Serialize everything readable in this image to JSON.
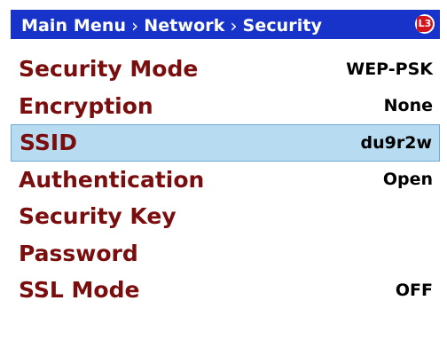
{
  "header": {
    "breadcrumb": [
      "Main Menu",
      "Network",
      "Security"
    ],
    "separator": "›",
    "logo_text": "L3"
  },
  "colors": {
    "header_bg": "#1733c9",
    "label_text": "#7a0e0e",
    "selected_bg": "#b7dbf1",
    "logo_red": "#d4141b"
  },
  "menu": {
    "items": [
      {
        "label": "Security Mode",
        "value": "WEP-PSK"
      },
      {
        "label": "Encryption",
        "value": "None"
      },
      {
        "label": "SSID",
        "value": "du9r2w",
        "selected": true
      },
      {
        "label": "Authentication",
        "value": "Open"
      },
      {
        "label": "Security Key",
        "value": ""
      },
      {
        "label": "Password",
        "value": ""
      },
      {
        "label": "SSL Mode",
        "value": "OFF"
      }
    ]
  }
}
